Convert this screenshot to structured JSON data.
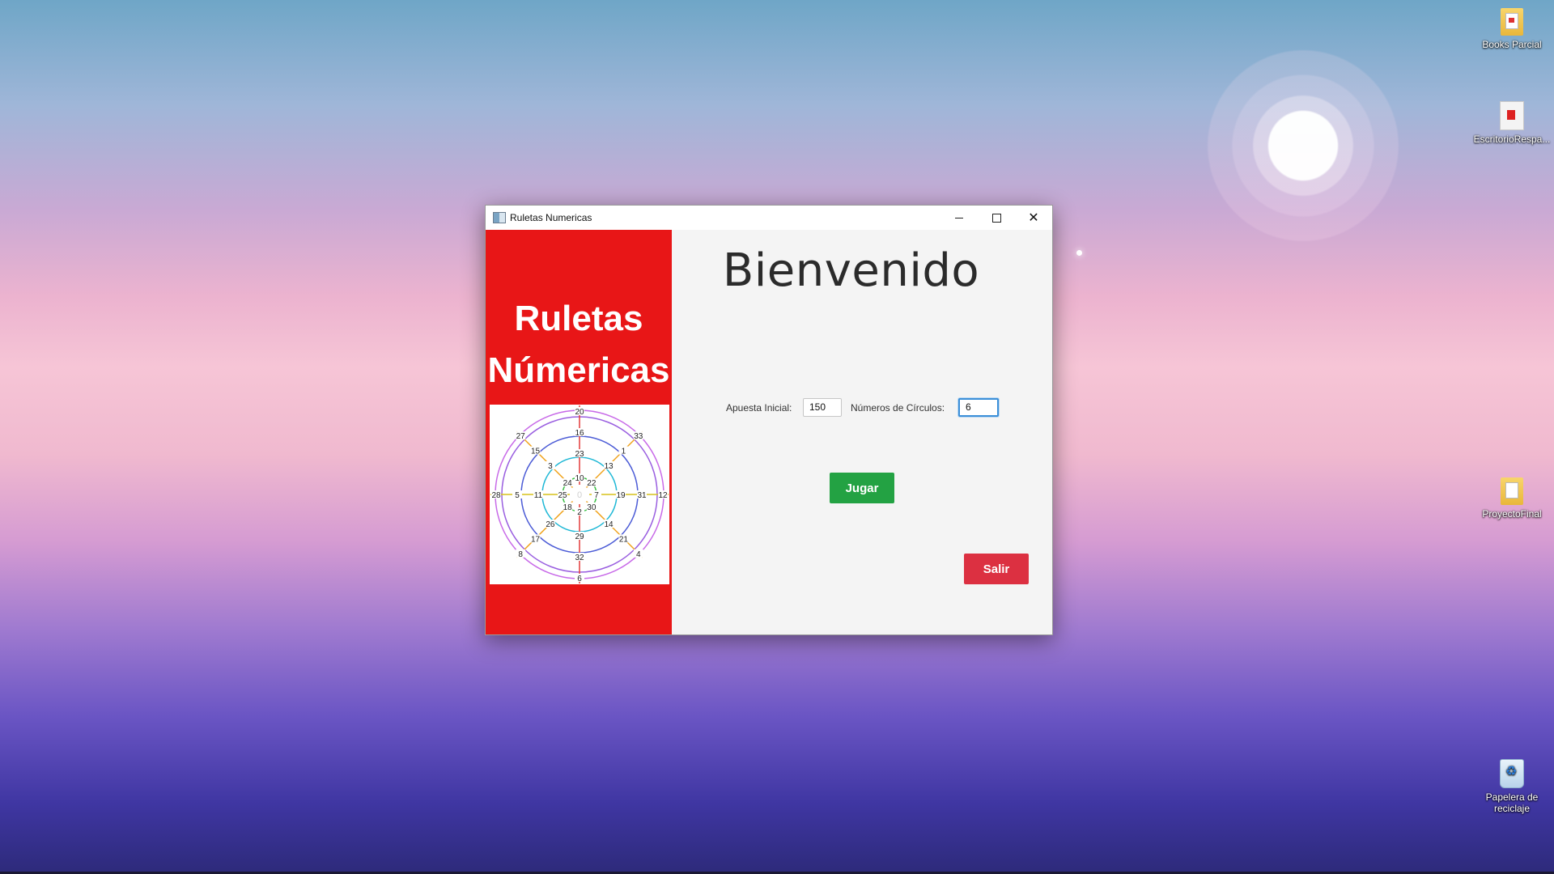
{
  "desktop": {
    "icons": [
      {
        "label": "Books Parcial",
        "icon": "pdf-folder-icon"
      },
      {
        "label": "EscritorioRespa...",
        "icon": "pdf-file-icon"
      },
      {
        "label": "ProyectoFinal",
        "icon": "folder-icon"
      },
      {
        "label": "Papelera de reciclaje",
        "icon": "recycle-bin-icon"
      }
    ]
  },
  "window": {
    "title": "Ruletas Numericas",
    "controls": {
      "minimize": "minimize-icon",
      "maximize": "maximize-icon",
      "close": "close-icon"
    }
  },
  "sidebar": {
    "title_line1": "Ruletas",
    "title_line2": "Númericas",
    "wheel": {
      "center": "0",
      "ring_colors": [
        "#3bbf45",
        "#1fb8d6",
        "#4b5bd6",
        "#9a5fe0",
        "#c86ae8"
      ],
      "spoke_colors": {
        "vertical": "#e23a3a",
        "horizontal": "#d7c21a",
        "diagonal": "#f0a21a"
      },
      "rings": [
        {
          "top": "10",
          "top_right": "22",
          "right": "7",
          "bottom_right": "30",
          "bottom": "2",
          "bottom_left": "18",
          "left": "25",
          "top_left": "24"
        },
        {
          "top": "23",
          "top_right": "13",
          "right": "19",
          "bottom_right": "14",
          "bottom": "29",
          "bottom_left": "26",
          "left": "11",
          "top_left": "3"
        },
        {
          "top": "16",
          "top_right": "1",
          "right": "31",
          "bottom_right": "21",
          "bottom": "32",
          "bottom_left": "17",
          "left": "5",
          "top_left": "15"
        },
        {
          "top": "20",
          "top_right": "33",
          "right": "12",
          "bottom_right": "4",
          "bottom": "6",
          "bottom_left": "8",
          "left": "28",
          "top_left": "27"
        }
      ]
    }
  },
  "main": {
    "heading": "Bienvenido",
    "bet_label": "Apuesta Inicial:",
    "bet_value": "150",
    "circles_label": "Números de Círculos:",
    "circles_value": "6",
    "play_button": "Jugar",
    "exit_button": "Salir",
    "accent_colors": {
      "play": "#23a243",
      "exit": "#dc3041",
      "sidebar": "#e81617"
    }
  }
}
